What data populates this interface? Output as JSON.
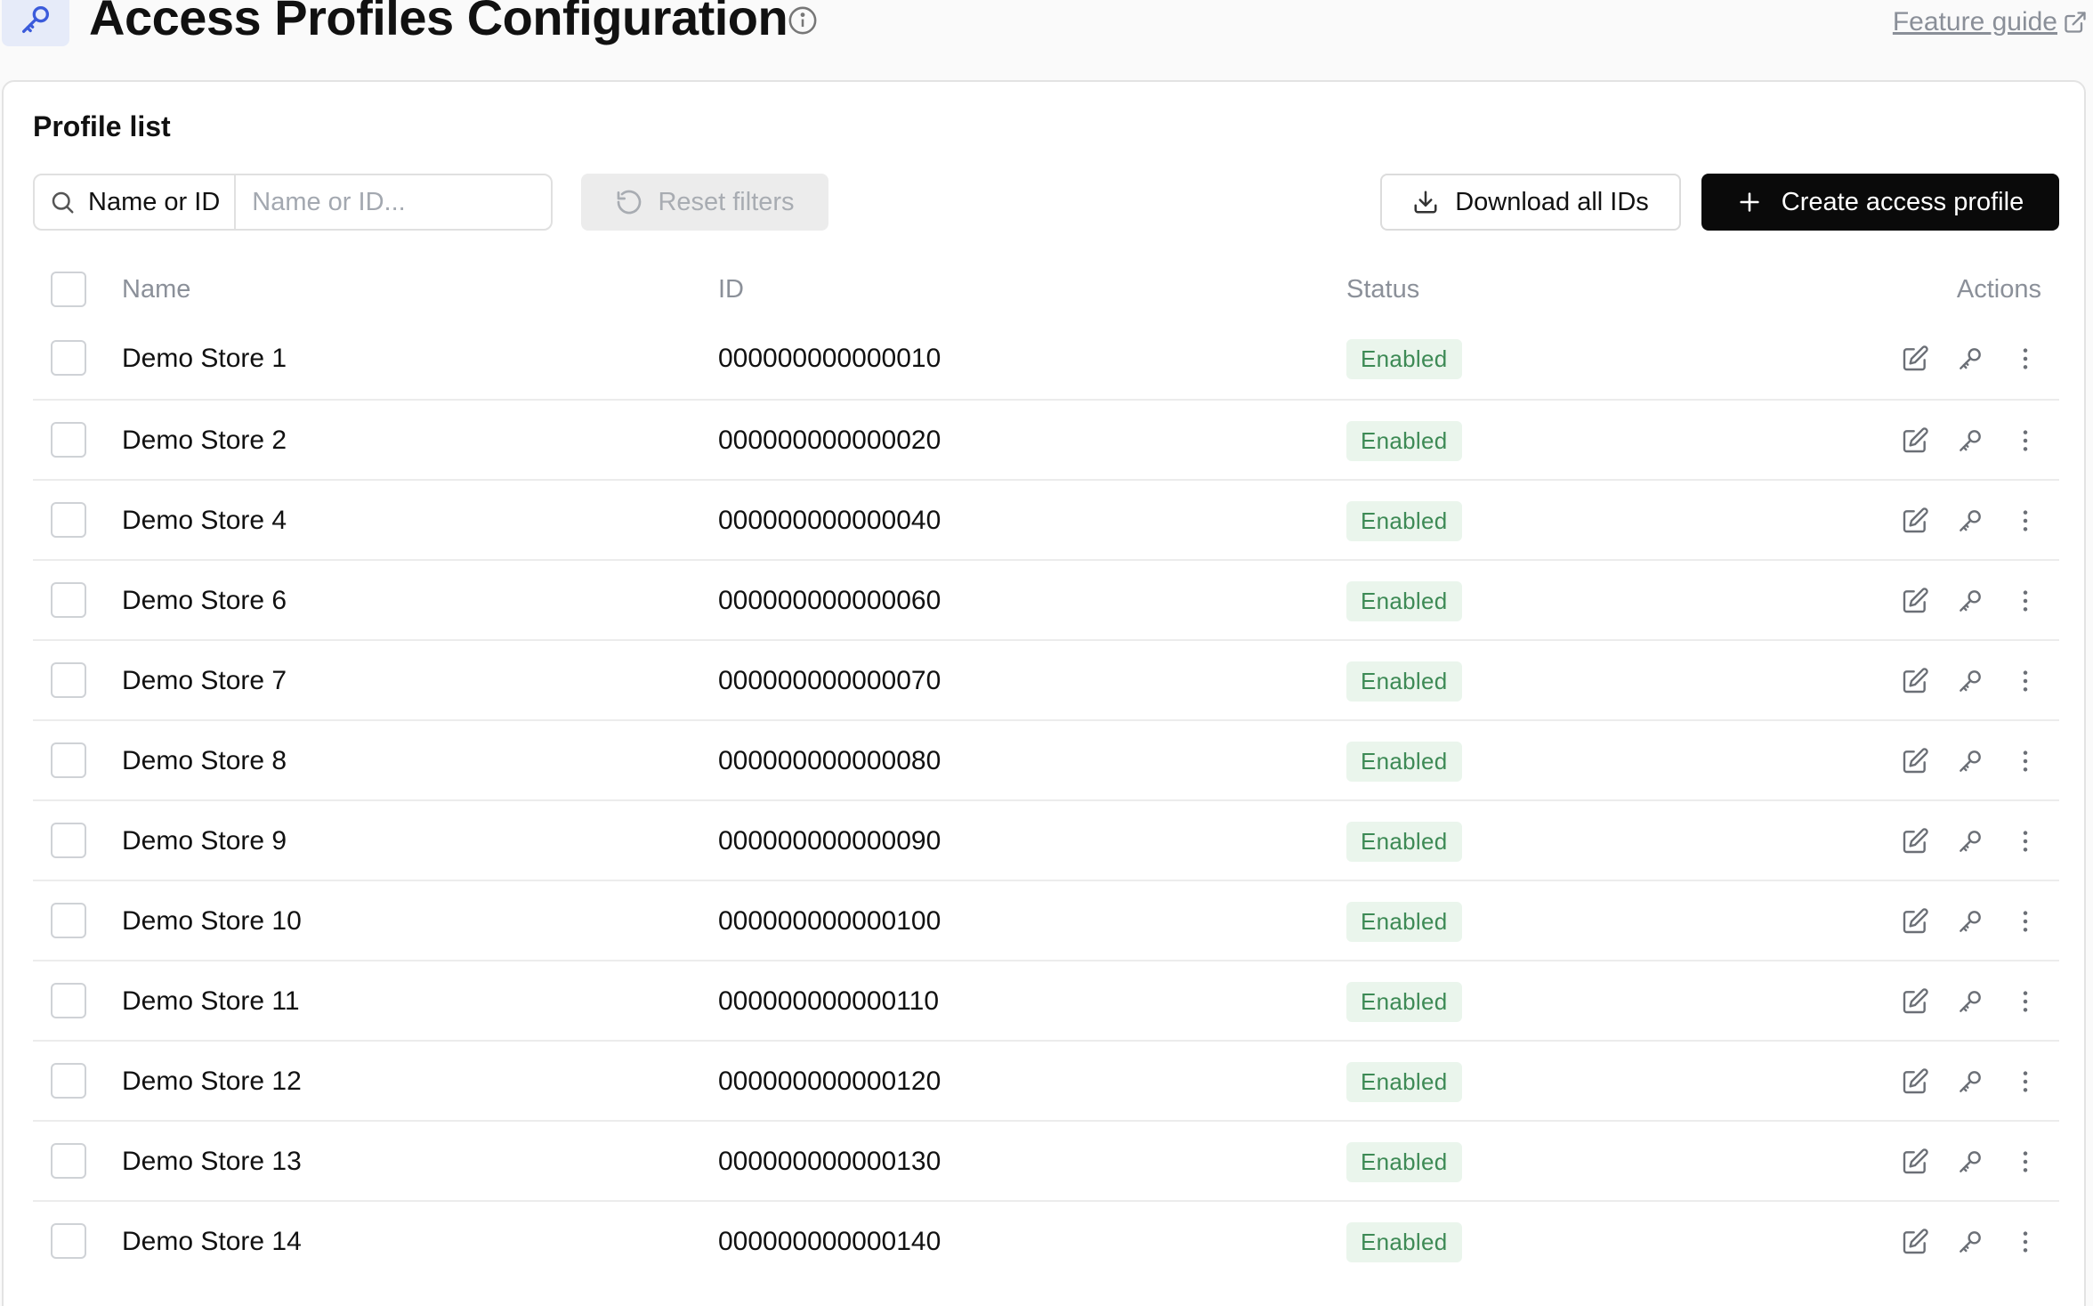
{
  "header": {
    "title": "Access Profiles Configuration",
    "feature_guide": "Feature guide",
    "icon": "key-icon"
  },
  "card": {
    "title": "Profile list"
  },
  "toolbar": {
    "filter_select_label": "Name or ID",
    "filter_placeholder": "Name or ID...",
    "filter_value": "",
    "reset_label": "Reset filters",
    "download_label": "Download all IDs",
    "create_label": "Create access profile"
  },
  "table": {
    "columns": [
      "Name",
      "ID",
      "Status",
      "Actions"
    ],
    "rows": [
      {
        "name": "Demo Store 1",
        "id": "000000000000010",
        "status": "Enabled"
      },
      {
        "name": "Demo Store 2",
        "id": "000000000000020",
        "status": "Enabled"
      },
      {
        "name": "Demo Store 4",
        "id": "000000000000040",
        "status": "Enabled"
      },
      {
        "name": "Demo Store 6",
        "id": "000000000000060",
        "status": "Enabled"
      },
      {
        "name": "Demo Store 7",
        "id": "000000000000070",
        "status": "Enabled"
      },
      {
        "name": "Demo Store 8",
        "id": "000000000000080",
        "status": "Enabled"
      },
      {
        "name": "Demo Store 9",
        "id": "000000000000090",
        "status": "Enabled"
      },
      {
        "name": "Demo Store 10",
        "id": "000000000000100",
        "status": "Enabled"
      },
      {
        "name": "Demo Store 11",
        "id": "000000000000110",
        "status": "Enabled"
      },
      {
        "name": "Demo Store 12",
        "id": "000000000000120",
        "status": "Enabled"
      },
      {
        "name": "Demo Store 13",
        "id": "000000000000130",
        "status": "Enabled"
      },
      {
        "name": "Demo Store 14",
        "id": "000000000000140",
        "status": "Enabled"
      }
    ]
  },
  "colors": {
    "accent": "#3b5bdb",
    "primary_button": "#0a0a0a",
    "status_enabled_bg": "#eaf5ec",
    "status_enabled_text": "#3d8a55"
  }
}
